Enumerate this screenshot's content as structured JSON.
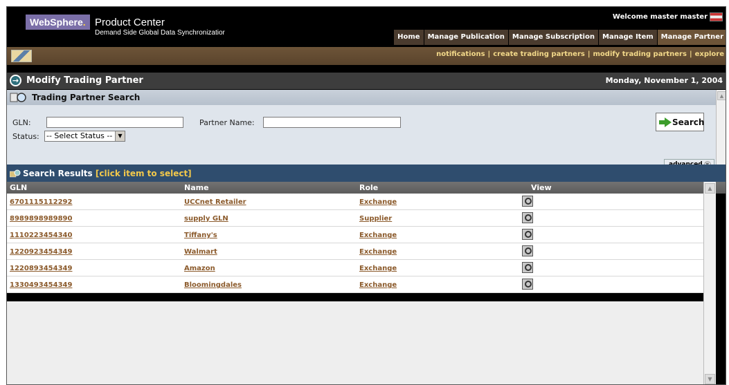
{
  "header": {
    "brand": "WebSphere",
    "product": "Product Center",
    "subtitle": "Demand Side Global Data Synchronizatior",
    "welcome": "Welcome master master",
    "nav": [
      "Home",
      "Manage Publication",
      "Manage Subscription",
      "Manage Item",
      "Manage Partner"
    ]
  },
  "sublinks": [
    "notifications",
    "create trading partners",
    "modify trading partners",
    "explore"
  ],
  "page": {
    "title": "Modify Trading Partner",
    "date": "Monday, November 1, 2004"
  },
  "search": {
    "title": "Trading Partner Search",
    "gln_label": "GLN:",
    "gln_value": "",
    "partner_label": "Partner Name:",
    "partner_value": "",
    "status_label": "Status:",
    "status_value": "-- Select Status --",
    "button": "Search",
    "advanced": "advanced"
  },
  "results": {
    "title": "Search Results",
    "hint": "[click item to select]",
    "columns": [
      "GLN",
      "Name",
      "Role",
      "View"
    ],
    "rows": [
      {
        "gln": "6701115112292",
        "name": "UCCnet Retailer",
        "role": "Exchange"
      },
      {
        "gln": "8989898989890",
        "name": "supply GLN",
        "role": "Supplier"
      },
      {
        "gln": "1110223454340",
        "name": "Tiffany's",
        "role": "Exchange"
      },
      {
        "gln": "1220923454349",
        "name": "Walmart",
        "role": "Exchange"
      },
      {
        "gln": "1220893454349",
        "name": "Amazon",
        "role": "Exchange"
      },
      {
        "gln": "1330493454349",
        "name": "Bloomingdales",
        "role": "Exchange"
      }
    ]
  },
  "colors": {
    "nav_bg": "#4a3b2e",
    "link": "#8b5a2b",
    "results_header": "#2f4d6e",
    "hint": "#f2c84b"
  }
}
